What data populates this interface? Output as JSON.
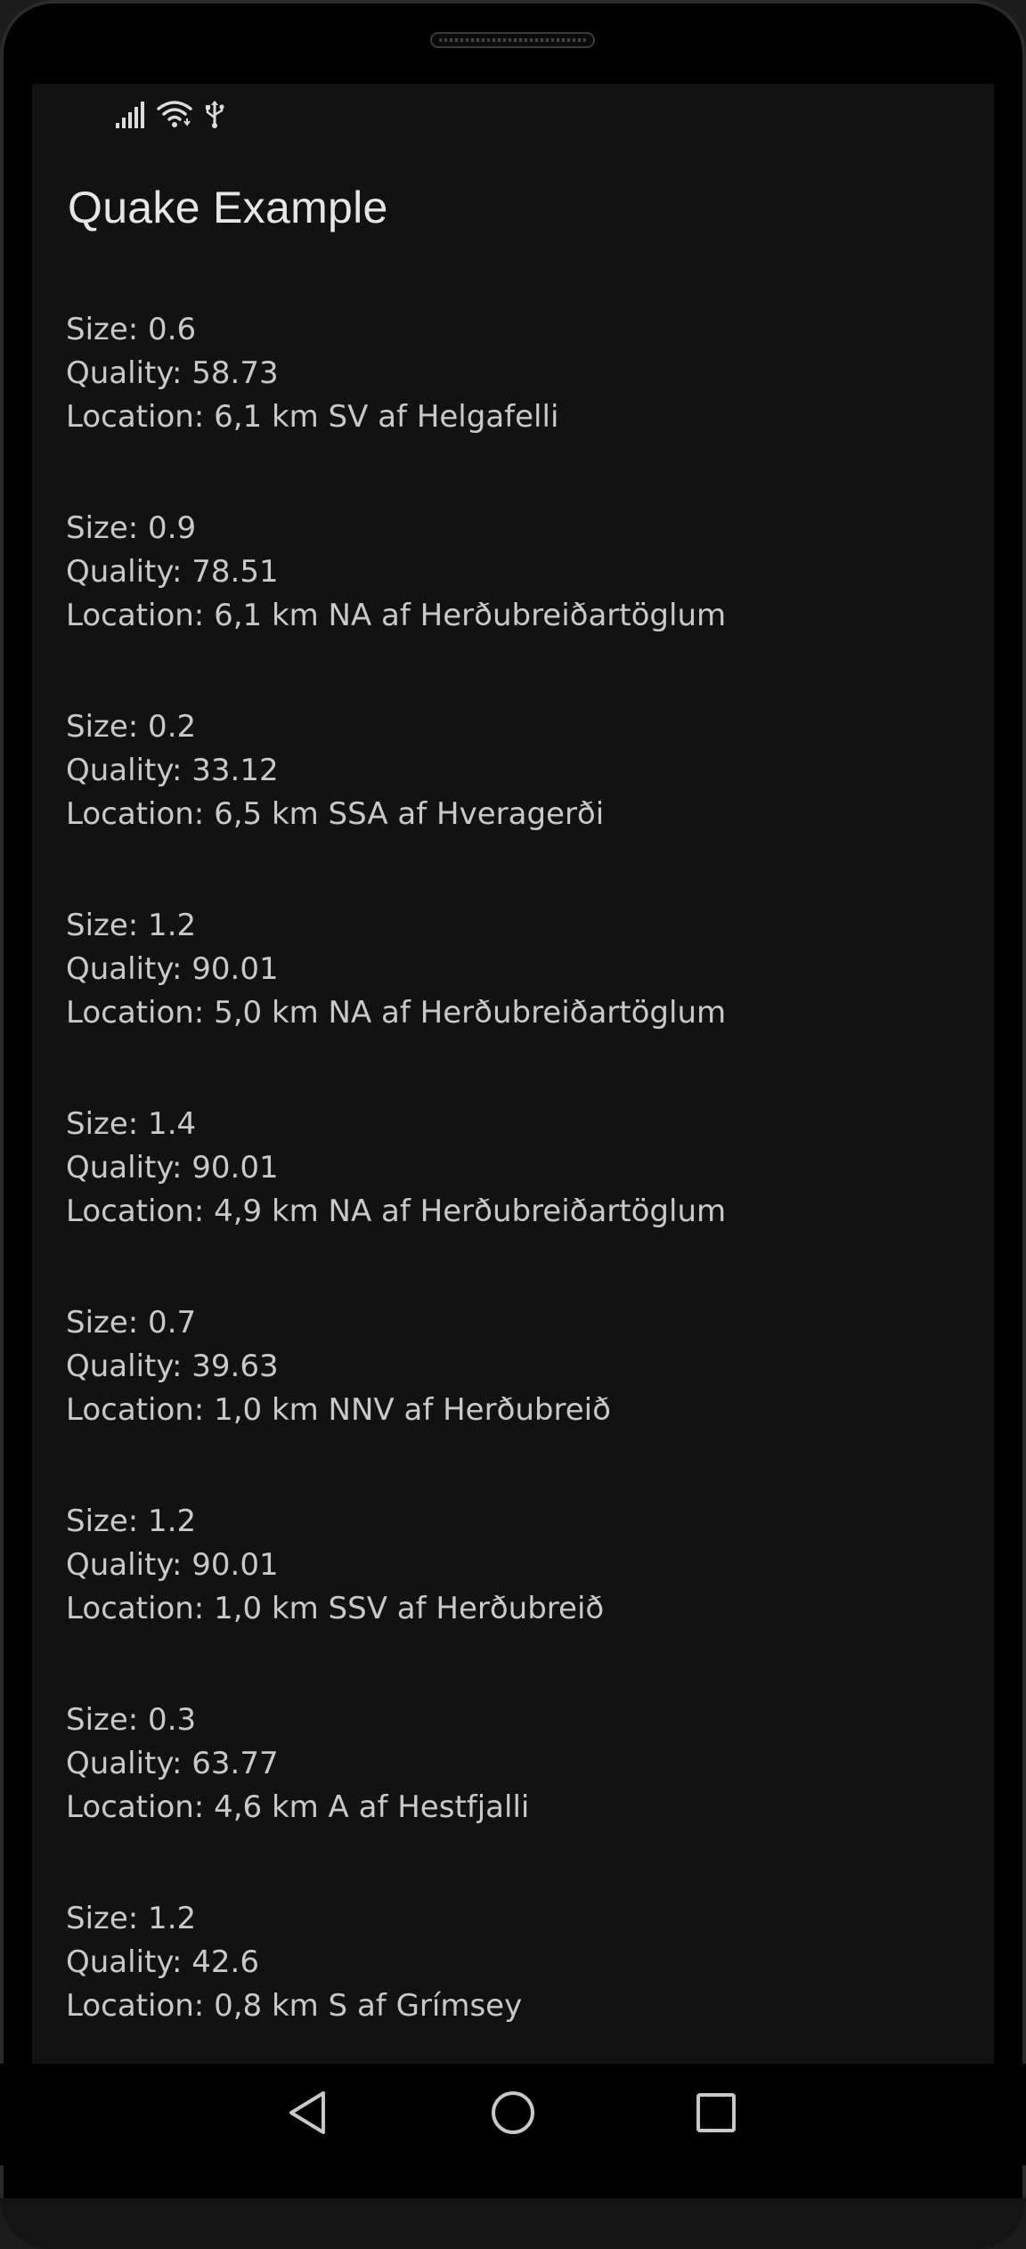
{
  "app": {
    "title": "Quake Example"
  },
  "status_bar": {
    "icons": [
      "signal-icon",
      "wifi-icon",
      "usb-icon"
    ]
  },
  "quakes": [
    {
      "size": "Size: 0.6",
      "quality": "Quality: 58.73",
      "location": "Location: 6,1 km SV af Helgafelli"
    },
    {
      "size": "Size: 0.9",
      "quality": "Quality: 78.51",
      "location": "Location: 6,1 km NA af Herðubreiðartöglum"
    },
    {
      "size": "Size: 0.2",
      "quality": "Quality: 33.12",
      "location": "Location: 6,5 km SSA af Hveragerði"
    },
    {
      "size": "Size: 1.2",
      "quality": "Quality: 90.01",
      "location": "Location: 5,0 km NA af Herðubreiðartöglum"
    },
    {
      "size": "Size: 1.4",
      "quality": "Quality: 90.01",
      "location": "Location: 4,9 km NA af Herðubreiðartöglum"
    },
    {
      "size": "Size: 0.7",
      "quality": "Quality: 39.63",
      "location": "Location: 1,0 km NNV af Herðubreið"
    },
    {
      "size": "Size: 1.2",
      "quality": "Quality: 90.01",
      "location": "Location: 1,0 km SSV af Herðubreið"
    },
    {
      "size": "Size: 0.3",
      "quality": "Quality: 63.77",
      "location": "Location: 4,6 km A af Hestfjalli"
    },
    {
      "size": "Size: 1.2",
      "quality": "Quality: 42.6",
      "location": "Location: 0,8 km S af Grímsey"
    }
  ],
  "nav_bar": {
    "buttons": [
      "back-icon",
      "home-icon",
      "recents-icon"
    ]
  },
  "colors": {
    "screen_background": "#121212",
    "title_text": "#e6e6e6",
    "body_text": "#c9c9c9"
  }
}
